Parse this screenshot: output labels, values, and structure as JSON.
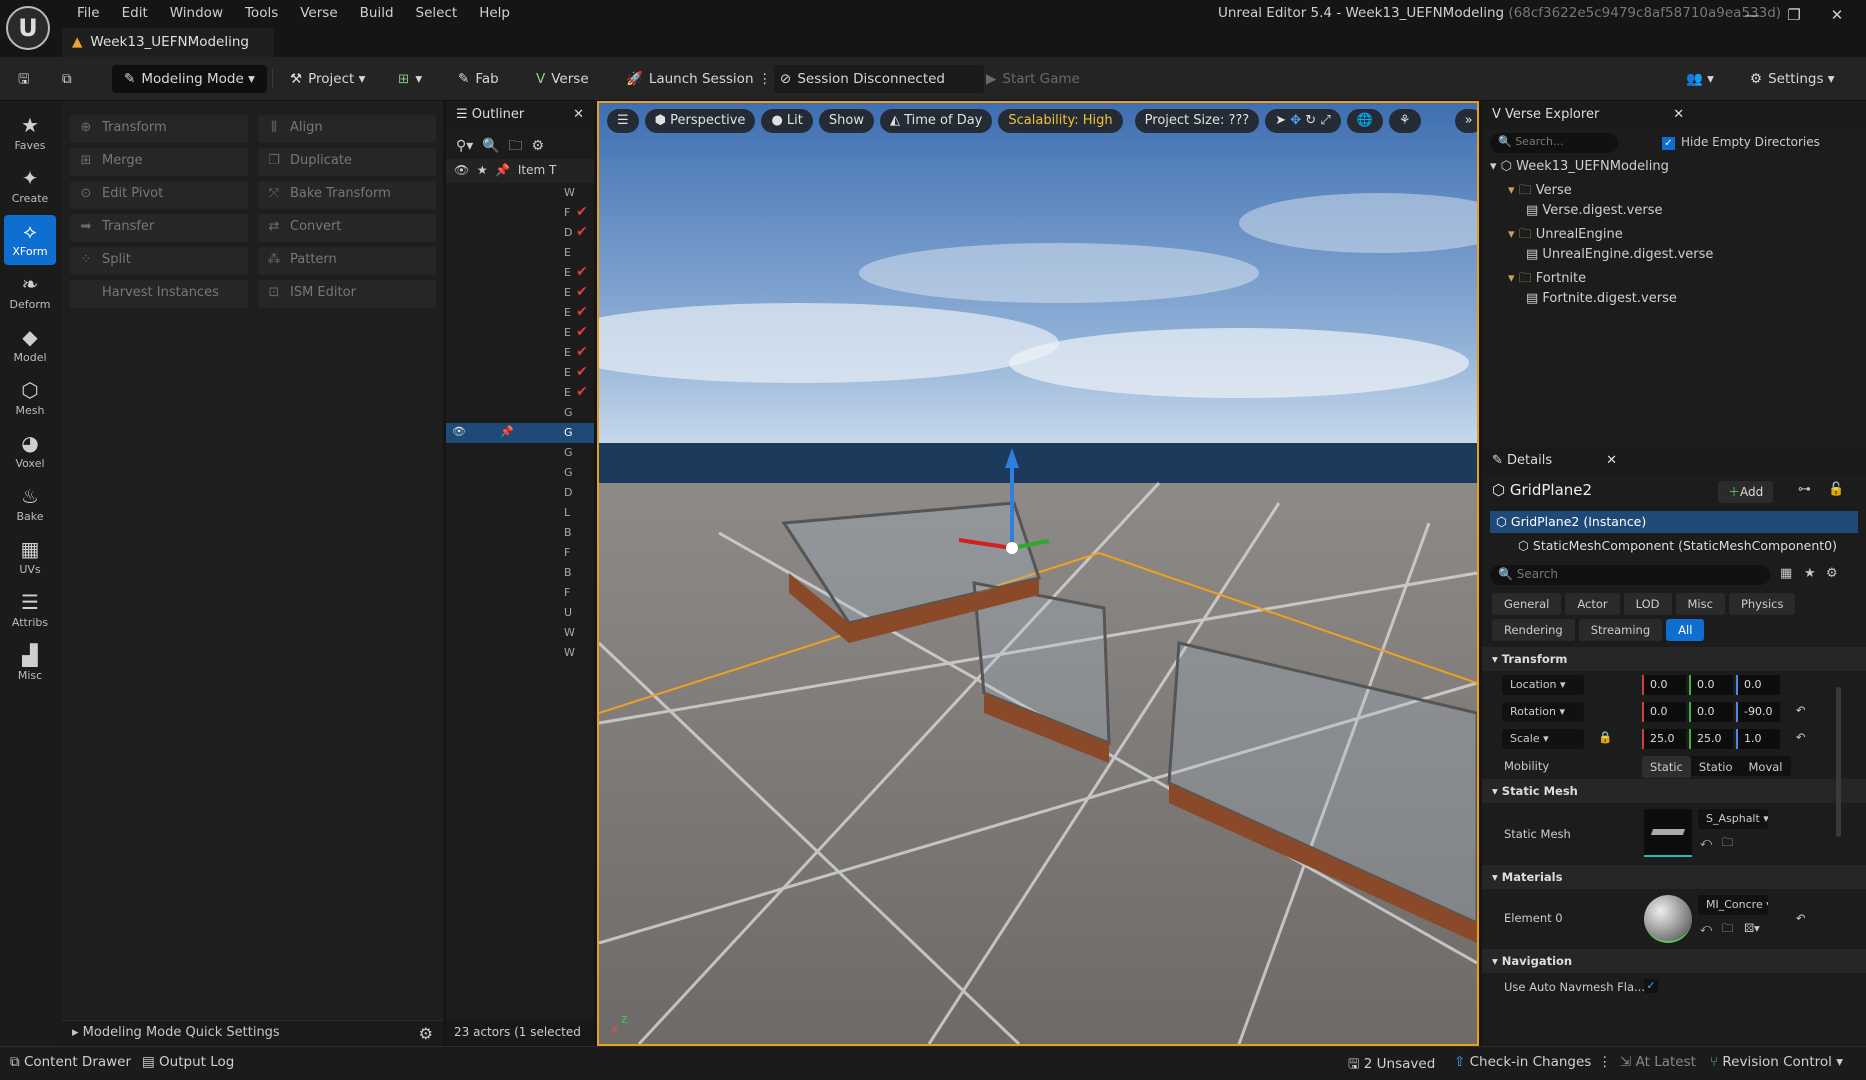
{
  "menu": [
    "File",
    "Edit",
    "Window",
    "Tools",
    "Verse",
    "Build",
    "Select",
    "Help"
  ],
  "project_tab": "Week13_UEFNModeling",
  "window_title": "Unreal Editor 5.4 - Week13_UEFNModeling",
  "window_hash": "(68cf3622e5c9479c8af58710a9ea533d)",
  "toolbar": {
    "mode": "Modeling Mode",
    "project": "Project",
    "fab": "Fab",
    "verse": "Verse",
    "launch": "Launch Session",
    "session": "Session Disconnected",
    "start": "Start Game",
    "settings": "Settings"
  },
  "leftbar": [
    {
      "icon": "star-icon",
      "glyph": "★",
      "label": "Faves"
    },
    {
      "icon": "create-icon",
      "glyph": "✦",
      "label": "Create"
    },
    {
      "icon": "xform-icon",
      "glyph": "⟡",
      "label": "XForm"
    },
    {
      "icon": "deform-icon",
      "glyph": "❧",
      "label": "Deform"
    },
    {
      "icon": "model-icon",
      "glyph": "◆",
      "label": "Model"
    },
    {
      "icon": "mesh-icon",
      "glyph": "⬡",
      "label": "Mesh"
    },
    {
      "icon": "voxel-icon",
      "glyph": "◕",
      "label": "Voxel"
    },
    {
      "icon": "bake-icon",
      "glyph": "♨",
      "label": "Bake"
    },
    {
      "icon": "uvs-icon",
      "glyph": "▦",
      "label": "UVs"
    },
    {
      "icon": "attribs-icon",
      "glyph": "☰",
      "label": "Attribs"
    },
    {
      "icon": "misc-icon",
      "glyph": "▟",
      "label": "Misc"
    }
  ],
  "tools": [
    {
      "label": "Transform",
      "glyph": "⊕"
    },
    {
      "label": "Align",
      "glyph": "⫼"
    },
    {
      "label": "Merge",
      "glyph": "⊞"
    },
    {
      "label": "Duplicate",
      "glyph": "❐"
    },
    {
      "label": "Edit Pivot",
      "glyph": "⊙"
    },
    {
      "label": "Bake Transform",
      "glyph": "⤧"
    },
    {
      "label": "Transfer",
      "glyph": "➡"
    },
    {
      "label": "Convert",
      "glyph": "⇄"
    },
    {
      "label": "Split",
      "glyph": "⁘"
    },
    {
      "label": "Pattern",
      "glyph": "⁂"
    },
    {
      "label": "Harvest Instances",
      "glyph": ""
    },
    {
      "label": "ISM Editor",
      "glyph": "⊡"
    }
  ],
  "quick_settings": "Modeling Mode Quick Settings",
  "outliner": {
    "title": "Outliner",
    "col_item": "Item",
    "col_type": "T",
    "rows": [
      "W",
      "F",
      "D",
      "E",
      "E",
      "E",
      "E",
      "E",
      "E",
      "E",
      "E",
      "G",
      "G",
      "G",
      "G",
      "D",
      "L",
      "B",
      "F",
      "B",
      "F",
      "U",
      "W",
      "W"
    ],
    "checked": [
      1,
      2,
      4,
      5,
      6,
      7,
      8,
      9,
      10
    ],
    "selected_index": 12,
    "status": "23 actors (1 selected"
  },
  "viewport": {
    "perspective": "Perspective",
    "lit": "Lit",
    "show": "Show",
    "time_of_day": "Time of Day",
    "scalability": "Scalability: High",
    "project_size": "Project Size: ???"
  },
  "verse_explorer": {
    "title": "Verse Explorer",
    "search_placeholder": "Search...",
    "hide_empty": "Hide Empty Directories",
    "tree": [
      {
        "label": "Week13_UEFNModeling",
        "level": 0,
        "type": "root"
      },
      {
        "label": "Verse",
        "level": 1,
        "type": "folder"
      },
      {
        "label": "Verse.digest.verse",
        "level": 2,
        "type": "file"
      },
      {
        "label": "UnrealEngine",
        "level": 1,
        "type": "folder"
      },
      {
        "label": "UnrealEngine.digest.verse",
        "level": 2,
        "type": "file"
      },
      {
        "label": "Fortnite",
        "level": 1,
        "type": "folder"
      },
      {
        "label": "Fortnite.digest.verse",
        "level": 2,
        "type": "file"
      }
    ]
  },
  "details": {
    "title": "Details",
    "object": "GridPlane2",
    "add": "Add",
    "instance": "GridPlane2 (Instance)",
    "component": "StaticMeshComponent (StaticMeshComponent0)",
    "search_placeholder": "Search",
    "filters_row1": [
      "General",
      "Actor",
      "LOD",
      "Misc",
      "Physics"
    ],
    "filters_row2": [
      "Rendering",
      "Streaming",
      "All"
    ],
    "transform": {
      "section": "Transform",
      "location_label": "Location",
      "rotation_label": "Rotation",
      "scale_label": "Scale",
      "location": [
        "0.0",
        "0.0",
        "0.0"
      ],
      "rotation": [
        "0.0",
        "0.0",
        "-90.0"
      ],
      "scale": [
        "25.0",
        "25.0",
        "1.0"
      ],
      "mobility_label": "Mobility",
      "mobility": [
        "Static",
        "Statio",
        "Moval"
      ]
    },
    "static_mesh": {
      "section": "Static Mesh",
      "label": "Static Mesh",
      "value": "S_Asphalt"
    },
    "materials": {
      "section": "Materials",
      "label": "Element 0",
      "value": "MI_Concre"
    },
    "navigation": {
      "section": "Navigation",
      "label": "Use Auto Navmesh Fla..."
    }
  },
  "bottom": {
    "content_drawer": "Content Drawer",
    "output_log": "Output Log",
    "unsaved": "2 Unsaved",
    "checkin": "Check-in Changes",
    "at_latest": "At Latest",
    "revision": "Revision Control"
  },
  "colors": {
    "accent": "#0e6fd1",
    "selection": "#e6a020",
    "error": "#e23b3b"
  }
}
